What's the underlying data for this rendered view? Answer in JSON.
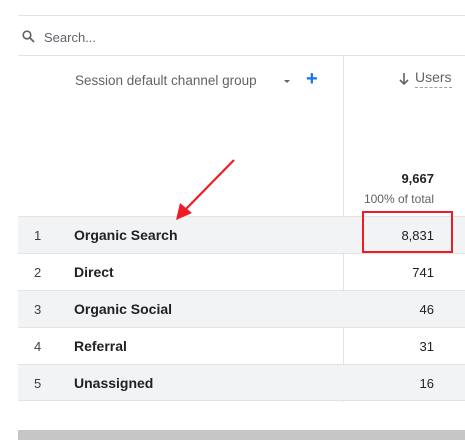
{
  "search": {
    "placeholder": "Search..."
  },
  "table": {
    "dimension_header": "Session default channel group",
    "metric_header": "Users",
    "total_value": "9,667",
    "total_percent": "100% of total",
    "rows": [
      {
        "index": "1",
        "channel": "Organic Search",
        "users": "8,831"
      },
      {
        "index": "2",
        "channel": "Direct",
        "users": "741"
      },
      {
        "index": "3",
        "channel": "Organic Social",
        "users": "46"
      },
      {
        "index": "4",
        "channel": "Referral",
        "users": "31"
      },
      {
        "index": "5",
        "channel": "Unassigned",
        "users": "16"
      }
    ]
  },
  "colors": {
    "accent": "#1a73e8",
    "annotation": "#ee1c25",
    "row_shade": "#f1f3f4"
  },
  "icons": {
    "search": "search-icon",
    "caret": "caret-down-icon",
    "add": "plus-icon",
    "sort": "arrow-down-icon"
  }
}
